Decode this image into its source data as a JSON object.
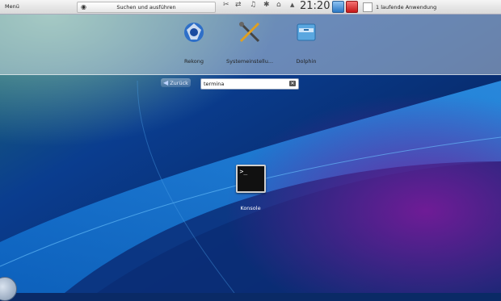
{
  "panel": {
    "menu_label": "Menü",
    "search_run_label": "Suchen und ausführen",
    "clock": "21:20",
    "tasks_label": "1 laufende Anwendung"
  },
  "favorites": [
    {
      "label": "Rekong",
      "icon": "rekonq-icon"
    },
    {
      "label": "Systemeinstellu...",
      "icon": "system-settings-icon"
    },
    {
      "label": "Dolphin",
      "icon": "dolphin-icon"
    }
  ],
  "search": {
    "back_label": "Zurück",
    "query": "termina"
  },
  "results": [
    {
      "label": "Konsole",
      "icon": "konsole-icon"
    }
  ],
  "colors": {
    "lock_blue": "#2a77c4",
    "power_red": "#c61717",
    "wallpaper_blue": "#0b3d8f",
    "wallpaper_purple": "#5a1a86"
  }
}
